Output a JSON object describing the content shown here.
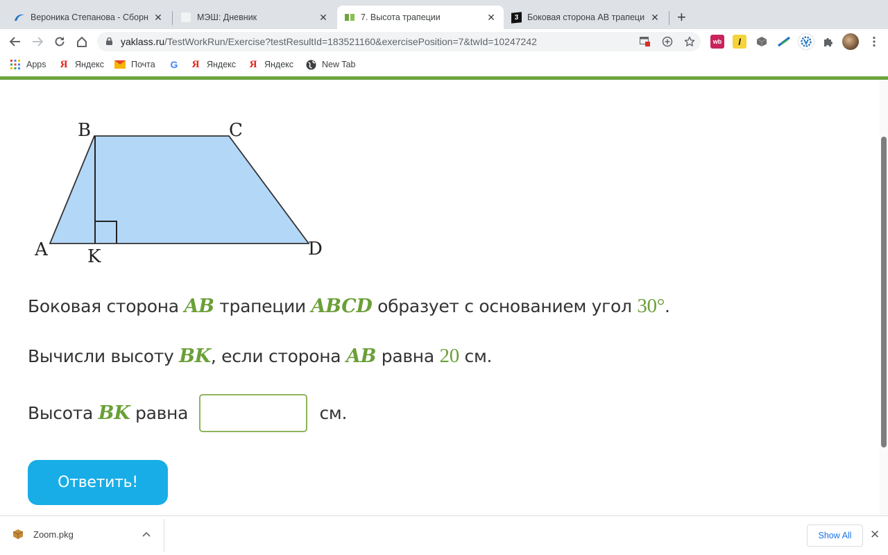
{
  "browser": {
    "tabs": [
      {
        "title": "Вероника Степанова - Сборн",
        "favicon": "blue-swoosh-icon",
        "active": false
      },
      {
        "title": "МЭШ: Дневник",
        "favicon": "blank-page-icon",
        "active": false
      },
      {
        "title": "7. Высота трапеции",
        "favicon": "yaklass-green-icon",
        "active": true
      },
      {
        "title": "Боковая сторона АВ трапеци",
        "favicon": "znanija-3-icon",
        "active": false
      }
    ],
    "new_tab_glyph": "+",
    "close_glyph": "✕",
    "url_host": "yaklass.ru",
    "url_path": "/TestWorkRun/Exercise?testResultId=183521160&exercisePosition=7&twId=10247242",
    "bookmarks": [
      {
        "label": "Apps",
        "icon": "apps-grid-icon"
      },
      {
        "label": "Яндекс",
        "icon": "yandex-icon"
      },
      {
        "label": "Почта",
        "icon": "mail-icon"
      },
      {
        "label": "",
        "icon": "google-icon"
      },
      {
        "label": "Яндекс",
        "icon": "yandex-icon"
      },
      {
        "label": "Яндекс",
        "icon": "yandex-icon"
      },
      {
        "label": "New Tab",
        "icon": "globe-icon"
      }
    ],
    "extensions": [
      "wildberries-icon",
      "yellow-l-icon",
      "box-icon",
      "blue-feather-icon",
      "vk-gear-icon",
      "puzzle-icon",
      "profile-avatar",
      "menu-dots-icon"
    ]
  },
  "figure": {
    "vertices": {
      "A": "A",
      "B": "B",
      "C": "C",
      "D": "D",
      "K": "K"
    },
    "fill_color": "#b3d7f7",
    "stroke_color": "#333333"
  },
  "problem": {
    "line1": {
      "t1": "Боковая сторона ",
      "m1": "AB",
      "t2": " трапеции ",
      "m2": "ABCD",
      "t3": " образует с основанием угол ",
      "n1": "30°",
      "t4": "."
    },
    "line2": {
      "t1": "Вычисли высоту ",
      "m1": "BK",
      "t2": ", если сторона ",
      "m2": "AB",
      "t3": " равна ",
      "n1": "20",
      "t4": " см."
    },
    "answer": {
      "t1": "Высота ",
      "m1": "BK",
      "t2": " равна",
      "value": "",
      "unit": "см."
    },
    "submit_label": "Ответить!",
    "accent_color": "#6b9f38",
    "button_color": "#18ade7"
  },
  "downloads": {
    "file_name": "Zoom.pkg",
    "show_all_label": "Show All",
    "close_glyph": "✕"
  }
}
